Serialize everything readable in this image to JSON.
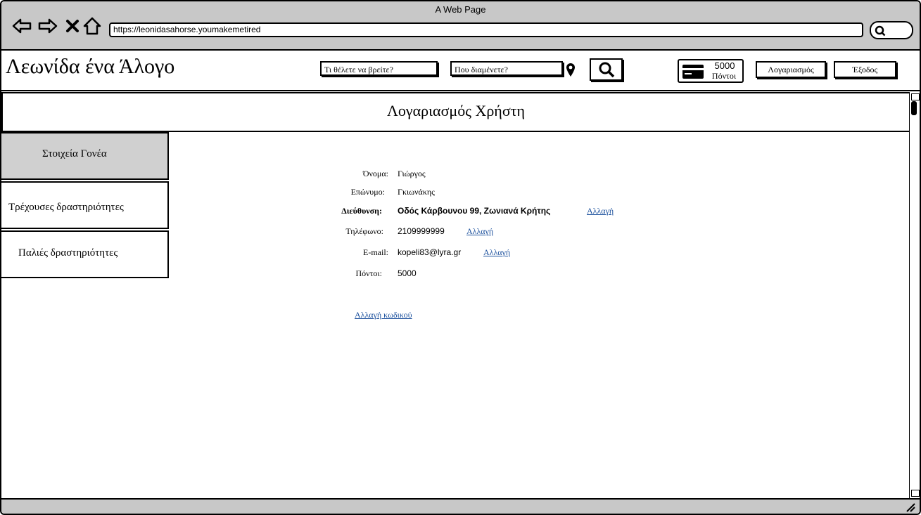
{
  "window": {
    "title": "A Web Page",
    "url": "https://leonidasahorse.youmakemetired"
  },
  "header": {
    "logo": "Λεωνίδα ένα Άλογο",
    "search_what_placeholder": "Τι θέλετε να βρείτε?",
    "search_where_placeholder": "Που διαμένετε?",
    "points_value": "5000",
    "points_label": "Πόντοι",
    "account_button": "Λογαριασμός",
    "logout_button": "Έξοδος"
  },
  "page": {
    "title": "Λογαριασμός Χρήστη"
  },
  "sidebar": {
    "items": [
      {
        "label": "Στοιχεία Γονέα"
      },
      {
        "label": "Τρέχουσες δραστηριότητες"
      },
      {
        "label": "Παλιές δραστηριότητες"
      }
    ]
  },
  "profile": {
    "name_label": "Όνομα:",
    "name_value": "Γιώργος",
    "surname_label": "Επώνυμο:",
    "surname_value": "Γκιωνάκης",
    "address_label": "Διεύθυνση:",
    "address_value": "Οδός Κάρβουνου 99, Ζωνιανά Κρήτης",
    "phone_label": "Τηλέφωνο:",
    "phone_value": "2109999999",
    "email_label": "E-mail:",
    "email_value": "kopeli83@lyra.gr",
    "points_label": "Πόντοι:",
    "points_value": "5000",
    "change_link": "Αλλαγή",
    "change_password_link": "Αλλαγή κωδικού"
  }
}
